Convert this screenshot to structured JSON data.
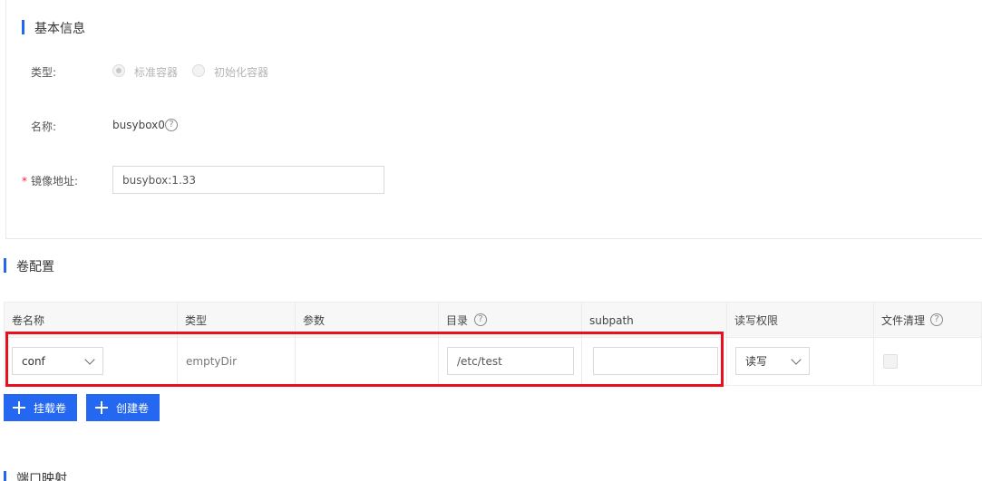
{
  "basic_info": {
    "title": "基本信息",
    "type_label": "类型:",
    "type_options": [
      "标准容器",
      "初始化容器"
    ],
    "type_selected": "标准容器",
    "name_label": "名称:",
    "name_value": "busybox0",
    "image_label": "镜像地址:",
    "image_required_mark": "*",
    "image_value": "busybox:1.33"
  },
  "volume": {
    "title": "卷配置",
    "columns": [
      "卷名称",
      "类型",
      "参数",
      "目录",
      "subpath",
      "读写权限",
      "文件清理"
    ],
    "row": {
      "name_select": "conf",
      "type": "emptyDir",
      "param": "",
      "dir_value": "/etc/test",
      "subpath_value": "",
      "permission_select": "读写",
      "file_cleanup_checked": false
    },
    "buttons": {
      "mount": "挂载卷",
      "create": "创建卷"
    }
  },
  "port_mapping": {
    "title": "端口映射"
  },
  "colors": {
    "accent": "#2468f2",
    "highlight": "#e8101f"
  },
  "icons": {
    "help": "question-circle-icon",
    "dropdown": "chevron-down-icon",
    "add": "plus-icon"
  }
}
